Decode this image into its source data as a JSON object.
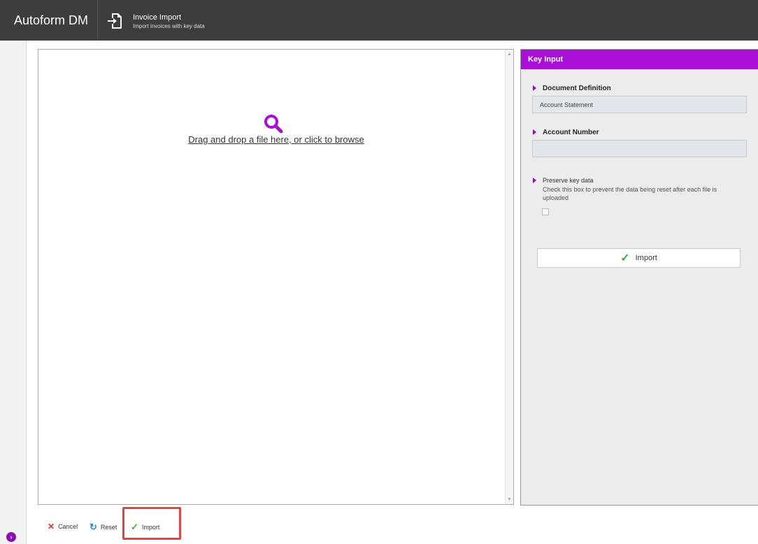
{
  "header": {
    "brand": "Autoform DM",
    "module_title": "Invoice Import",
    "module_subtitle": "Import invoices with key data"
  },
  "dropzone": {
    "prompt": "Drag and drop a file here, or click to browse",
    "icon": "search-icon"
  },
  "key_input": {
    "title": "Key Input",
    "document_definition_label": "Document Definition",
    "document_definition_value": "Account Statement",
    "account_number_label": "Account Number",
    "account_number_value": "",
    "preserve_label": "Preserve key data",
    "preserve_help": "Check this box to prevent the data being reset after each file is uploaded",
    "preserve_checked": false,
    "import_label": "Import"
  },
  "bottom_bar": {
    "cancel_label": "Cancel",
    "reset_label": "Reset",
    "import_label": "Import"
  },
  "colors": {
    "accent": "#a90fd6",
    "header_bg": "#3d3d3d",
    "success": "#3fae49",
    "danger": "#d9322b",
    "highlight": "#e04545"
  }
}
